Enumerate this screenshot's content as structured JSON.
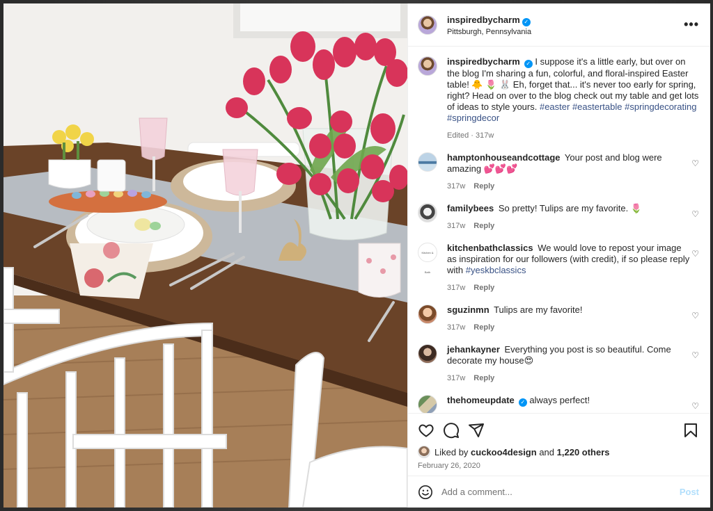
{
  "post": {
    "username": "inspiredbycharm",
    "location": "Pittsburgh, Pennsylvania",
    "more_icon": "more-horizontal-icon"
  },
  "caption": {
    "username": "inspiredbycharm",
    "text_1": "I suppose it's a little early, but over on the blog I'm sharing a fun, colorful, and floral-inspired Easter table! 🐥 🌷 🐰 Eh, forget that... it's never too early for spring, right? Head on over to the blog check out my table and get lots of ideas to style yours.",
    "hashtags": "#easter #eastertable #springdecorating #springdecor",
    "edited": "Edited · 317w"
  },
  "comments": [
    {
      "username": "hamptonhouseandcottage",
      "text": "Your post and blog were amazing 💕💕💕",
      "age": "317w",
      "reply": "Reply"
    },
    {
      "username": "familybees",
      "text": "So pretty! Tulips are my favorite. 🌷",
      "age": "317w",
      "reply": "Reply"
    },
    {
      "username": "kitchenbathclassics",
      "text": "We would love to repost your image as inspiration for our followers (with credit), if so please reply with",
      "tag": "#yeskbclassics",
      "age": "317w",
      "reply": "Reply",
      "avatar_text": "Kitchen & Bath"
    },
    {
      "username": "sguzinmn",
      "text": "Tulips are my favorite!",
      "age": "317w",
      "reply": "Reply"
    },
    {
      "username": "jehankayner",
      "text": "Everything you post is so beautiful. Come decorate my house😍",
      "age": "317w",
      "reply": "Reply"
    },
    {
      "username": "thehomeupdate",
      "text": "always perfect!"
    }
  ],
  "likes": {
    "prefix": "Liked by",
    "user": "cuckoo4design",
    "and": "and",
    "others": "1,220 others"
  },
  "date": "February 26, 2020",
  "composer": {
    "placeholder": "Add a comment...",
    "post_label": "Post"
  },
  "colors": {
    "link": "#385185",
    "verified": "#0095f6",
    "post_disabled": "#b2dffc"
  }
}
